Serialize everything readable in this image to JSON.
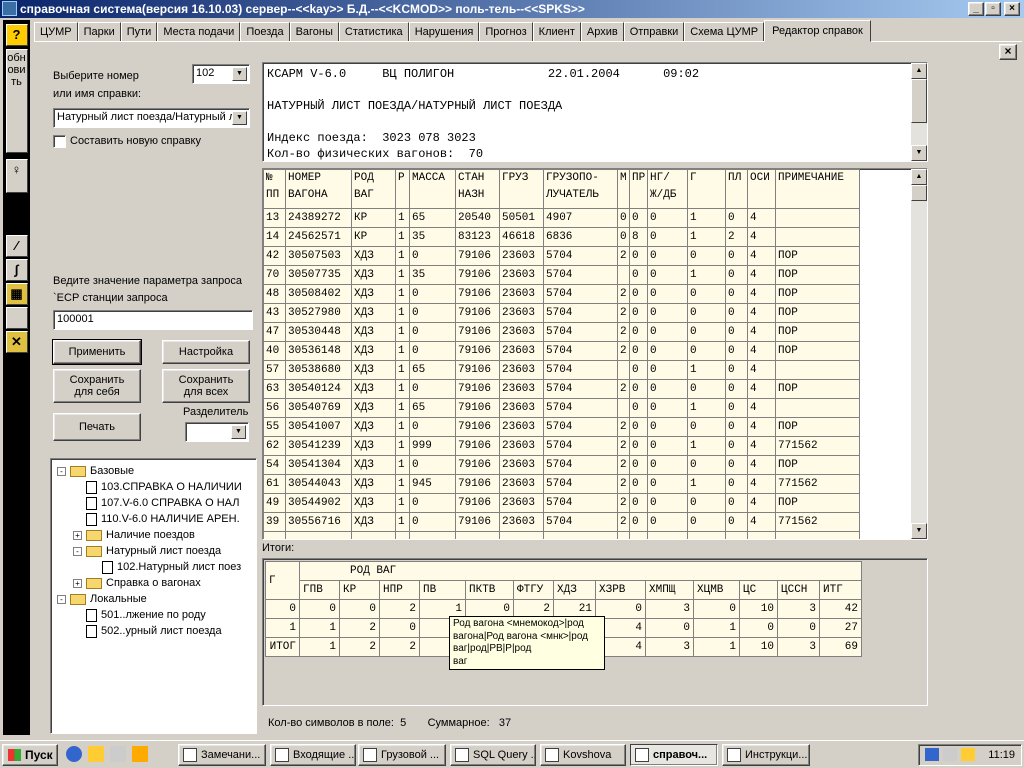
{
  "window": {
    "title": "справочная система(версия 16.10.03) сервер--<<kay>> Б.Д.--<<KCMOD>> поль-тель--<<SPKS>>"
  },
  "tabs": [
    "ЦУМР",
    "Парки",
    "Пути",
    "Места подачи",
    "Поезда",
    "Вагоны",
    "Статистика",
    "Нарушения",
    "Прогноз",
    "Клиент",
    "Архив",
    "Отправки",
    "Схема ЦУМР",
    "Редактор справок"
  ],
  "left_strip": {
    "help": "?",
    "refresh": "обновить"
  },
  "form": {
    "select_label_1": "Выберите номер",
    "select_label_2": "или имя справки:",
    "number_value": "102",
    "name_value": "Натурный лист поезда/Натурный л",
    "new_report_label": "Составить новую справку",
    "param_label_1": "Ведите значение параметра запроса",
    "param_label_2": "`ЕСР станции запроса",
    "param_value": "100001",
    "apply": "Применить",
    "settings": "Настройка",
    "save_self": "Сохранить для себя",
    "save_all": "Сохранить для всех",
    "separator_label": "Разделитель",
    "print": "Печать"
  },
  "tree": [
    {
      "level": 0,
      "exp": "-",
      "icon": "folder",
      "label": "Базовые"
    },
    {
      "level": 1,
      "exp": "",
      "icon": "doc",
      "label": "103.СПРАВКА О НАЛИЧИИ"
    },
    {
      "level": 1,
      "exp": "",
      "icon": "doc",
      "label": "107.V-6.0  СПРАВКА О НАЛ"
    },
    {
      "level": 1,
      "exp": "",
      "icon": "doc",
      "label": "110.V-6.0  НАЛИЧИЕ АРЕН."
    },
    {
      "level": 1,
      "exp": "+",
      "icon": "folder",
      "label": "Наличие поездов"
    },
    {
      "level": 1,
      "exp": "-",
      "icon": "folder",
      "label": "Натурный лист поезда"
    },
    {
      "level": 2,
      "exp": "",
      "icon": "doc",
      "label": "102.Натурный лист поез"
    },
    {
      "level": 1,
      "exp": "+",
      "icon": "folder",
      "label": "Справка о вагонах"
    },
    {
      "level": 0,
      "exp": "-",
      "icon": "folder",
      "label": "Локальные"
    },
    {
      "level": 1,
      "exp": "",
      "icon": "doc",
      "label": "501..лжение по роду"
    },
    {
      "level": 1,
      "exp": "",
      "icon": "doc",
      "label": "502..урный лист поезда"
    }
  ],
  "report_header": {
    "lines": [
      "КСАРМ V-6.0     ВЦ ПОЛИГОН             22.01.2004      09:02",
      "",
      "НАТУРНЫЙ ЛИСТ ПОЕЗДА/НАТУРНЫЙ ЛИСТ ПОЕЗДА",
      "",
      "Индекс поезда:  3023 078 3023",
      "Кол-во физических вагонов:  70"
    ]
  },
  "main_table": {
    "headers": [
      "№\nПП",
      "НОМЕР\nВАГОНА",
      "РОД\nВАГ",
      "Р",
      "МАССА",
      "СТАН\nНАЗН",
      "ГРУЗ",
      "ГРУЗОПО-\nЛУЧАТЕЛЬ",
      "М",
      "ПР",
      "НГ/\nЖ/ДБ",
      "Г",
      "ПЛ",
      "ОСИ",
      "ПРИМЕЧАНИЕ"
    ],
    "rows": [
      [
        "13",
        "24389272",
        "КР",
        "1",
        "65",
        "20540",
        "50501",
        "4907",
        "0",
        "0",
        "0",
        "1",
        "0",
        "4",
        ""
      ],
      [
        "14",
        "24562571",
        "КР",
        "1",
        "35",
        "83123",
        "46618",
        "6836",
        "0",
        "8",
        "0",
        "1",
        "2",
        "4",
        ""
      ],
      [
        "42",
        "30507503",
        "ХДЗ",
        "1",
        "0",
        "79106",
        "23603",
        "5704",
        "2",
        "0",
        "0",
        "0",
        "0",
        "4",
        "ПОР"
      ],
      [
        "70",
        "30507735",
        "ХДЗ",
        "1",
        "35",
        "79106",
        "23603",
        "5704",
        "",
        "0",
        "0",
        "1",
        "0",
        "4",
        "ПОР"
      ],
      [
        "48",
        "30508402",
        "ХДЗ",
        "1",
        "0",
        "79106",
        "23603",
        "5704",
        "2",
        "0",
        "0",
        "0",
        "0",
        "4",
        "ПОР"
      ],
      [
        "43",
        "30527980",
        "ХДЗ",
        "1",
        "0",
        "79106",
        "23603",
        "5704",
        "2",
        "0",
        "0",
        "0",
        "0",
        "4",
        "ПОР"
      ],
      [
        "47",
        "30530448",
        "ХДЗ",
        "1",
        "0",
        "79106",
        "23603",
        "5704",
        "2",
        "0",
        "0",
        "0",
        "0",
        "4",
        "ПОР"
      ],
      [
        "40",
        "30536148",
        "ХДЗ",
        "1",
        "0",
        "79106",
        "23603",
        "5704",
        "2",
        "0",
        "0",
        "0",
        "0",
        "4",
        "ПОР"
      ],
      [
        "57",
        "30538680",
        "ХДЗ",
        "1",
        "65",
        "79106",
        "23603",
        "5704",
        "",
        "0",
        "0",
        "1",
        "0",
        "4",
        ""
      ],
      [
        "63",
        "30540124",
        "ХДЗ",
        "1",
        "0",
        "79106",
        "23603",
        "5704",
        "2",
        "0",
        "0",
        "0",
        "0",
        "4",
        "ПОР"
      ],
      [
        "56",
        "30540769",
        "ХДЗ",
        "1",
        "65",
        "79106",
        "23603",
        "5704",
        "",
        "0",
        "0",
        "1",
        "0",
        "4",
        ""
      ],
      [
        "55",
        "30541007",
        "ХДЗ",
        "1",
        "0",
        "79106",
        "23603",
        "5704",
        "2",
        "0",
        "0",
        "0",
        "0",
        "4",
        "ПОР"
      ],
      [
        "62",
        "30541239",
        "ХДЗ",
        "1",
        "999",
        "79106",
        "23603",
        "5704",
        "2",
        "0",
        "0",
        "1",
        "0",
        "4",
        "771562"
      ],
      [
        "54",
        "30541304",
        "ХДЗ",
        "1",
        "0",
        "79106",
        "23603",
        "5704",
        "2",
        "0",
        "0",
        "0",
        "0",
        "4",
        "ПОР"
      ],
      [
        "61",
        "30544043",
        "ХДЗ",
        "1",
        "945",
        "79106",
        "23603",
        "5704",
        "2",
        "0",
        "0",
        "1",
        "0",
        "4",
        "771562"
      ],
      [
        "49",
        "30544902",
        "ХДЗ",
        "1",
        "0",
        "79106",
        "23603",
        "5704",
        "2",
        "0",
        "0",
        "0",
        "0",
        "4",
        "ПОР"
      ],
      [
        "39",
        "30556716",
        "ХДЗ",
        "1",
        "0",
        "79106",
        "23603",
        "5704",
        "2",
        "0",
        "0",
        "0",
        "0",
        "4",
        "771562"
      ]
    ]
  },
  "totals": {
    "label": "Итоги:",
    "corner": "Г",
    "group": "РОД ВАГ",
    "columns": [
      "ГПВ",
      "КР",
      "НПР",
      "ПВ",
      "ПКТВ",
      "ФТГУ",
      "ХДЗ",
      "ХЗРВ",
      "ХМПЩ",
      "ХЦМВ",
      "ЦС",
      "ЦССН",
      "ИТГ"
    ],
    "rows": [
      {
        "g": "0",
        "v": [
          "0",
          "0",
          "2",
          "1",
          "0",
          "2",
          "21",
          "0",
          "3",
          "0",
          "10",
          "3",
          "42"
        ]
      },
      {
        "g": "1",
        "v": [
          "1",
          "2",
          "0",
          "",
          "",
          "",
          "",
          "4",
          "0",
          "1",
          "0",
          "0",
          "27"
        ]
      },
      {
        "g": "ИТОГ",
        "v": [
          "1",
          "2",
          "2",
          "",
          "",
          "",
          "",
          "4",
          "3",
          "1",
          "10",
          "3",
          "69"
        ]
      }
    ]
  },
  "tooltip": [
    "Род вагона <мнемокод>|род",
    "вагона|Род вагона <мнк>|род",
    "ваг|род|РВ|Р|род",
    "ваг"
  ],
  "status": {
    "chars_label": "Кол-во символов в поле:",
    "chars_value": "5",
    "sum_label": "Суммарное:",
    "sum_value": "37"
  },
  "taskbar": {
    "start": "Пуск",
    "tasks": [
      "Замечани...",
      "Входящие ...",
      "Грузовой ...",
      "SQL Query ...",
      "Kovshova",
      "справоч...",
      "Инструкци..."
    ],
    "clock": "11:19"
  }
}
